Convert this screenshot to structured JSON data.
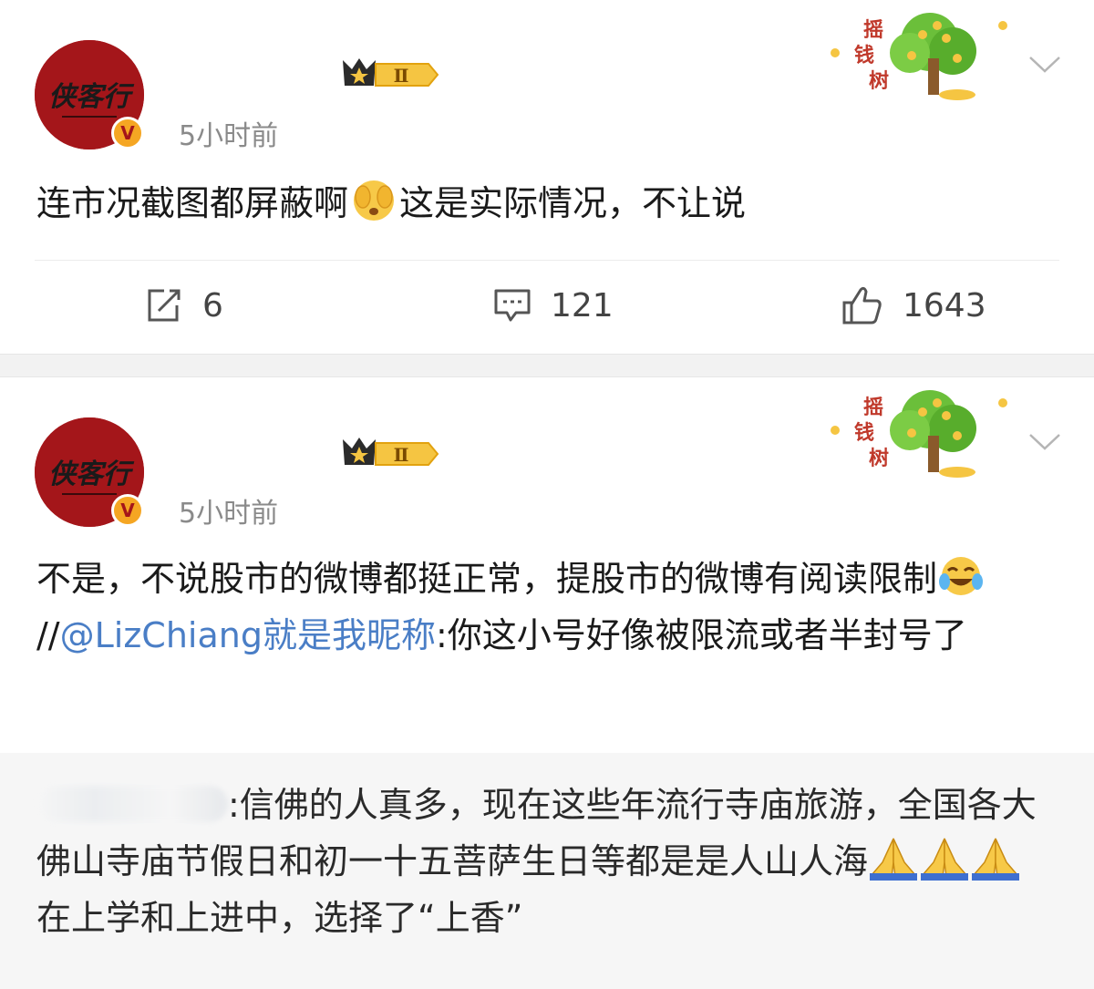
{
  "posts": [
    {
      "time": "5小时前",
      "badge_level": "Ⅱ",
      "tree_label": "摇钱树",
      "avatar_text": "侠客行",
      "verified_mark": "V",
      "text_before_emoji": "连市况截图都屏蔽啊",
      "emoji": "shock-face-emoji",
      "text_after_emoji": "这是实际情况，不让说",
      "actions": {
        "repost_count": "6",
        "comment_count": "121",
        "like_count": "1643"
      }
    },
    {
      "time": "5小时前",
      "badge_level": "Ⅱ",
      "tree_label": "摇钱树",
      "avatar_text": "侠客行",
      "verified_mark": "V",
      "text_before_emoji": "不是，不说股市的微博都挺正常，提股市的微博有阅读限制",
      "emoji": "crying-laughing-emoji",
      "separator": "//",
      "mention": "@LizChiang就是我昵称",
      "text_after_mention": ":你这小号好像被限流或者半封号了",
      "repost": {
        "text": ":信佛的人真多，现在这些年流行寺庙旅游，全国各大佛山寺庙节假日和初一十五菩萨生日等都是是人山人海",
        "emoji": "folded-hands-emoji",
        "text_after": "在上学和上进中，选择了“上香”"
      }
    }
  ],
  "colors": {
    "avatar_red": "#a4161a",
    "mention_blue": "#4a7ec6",
    "badge_gold": "#f5c542",
    "gray_text": "#8a8a8a"
  }
}
